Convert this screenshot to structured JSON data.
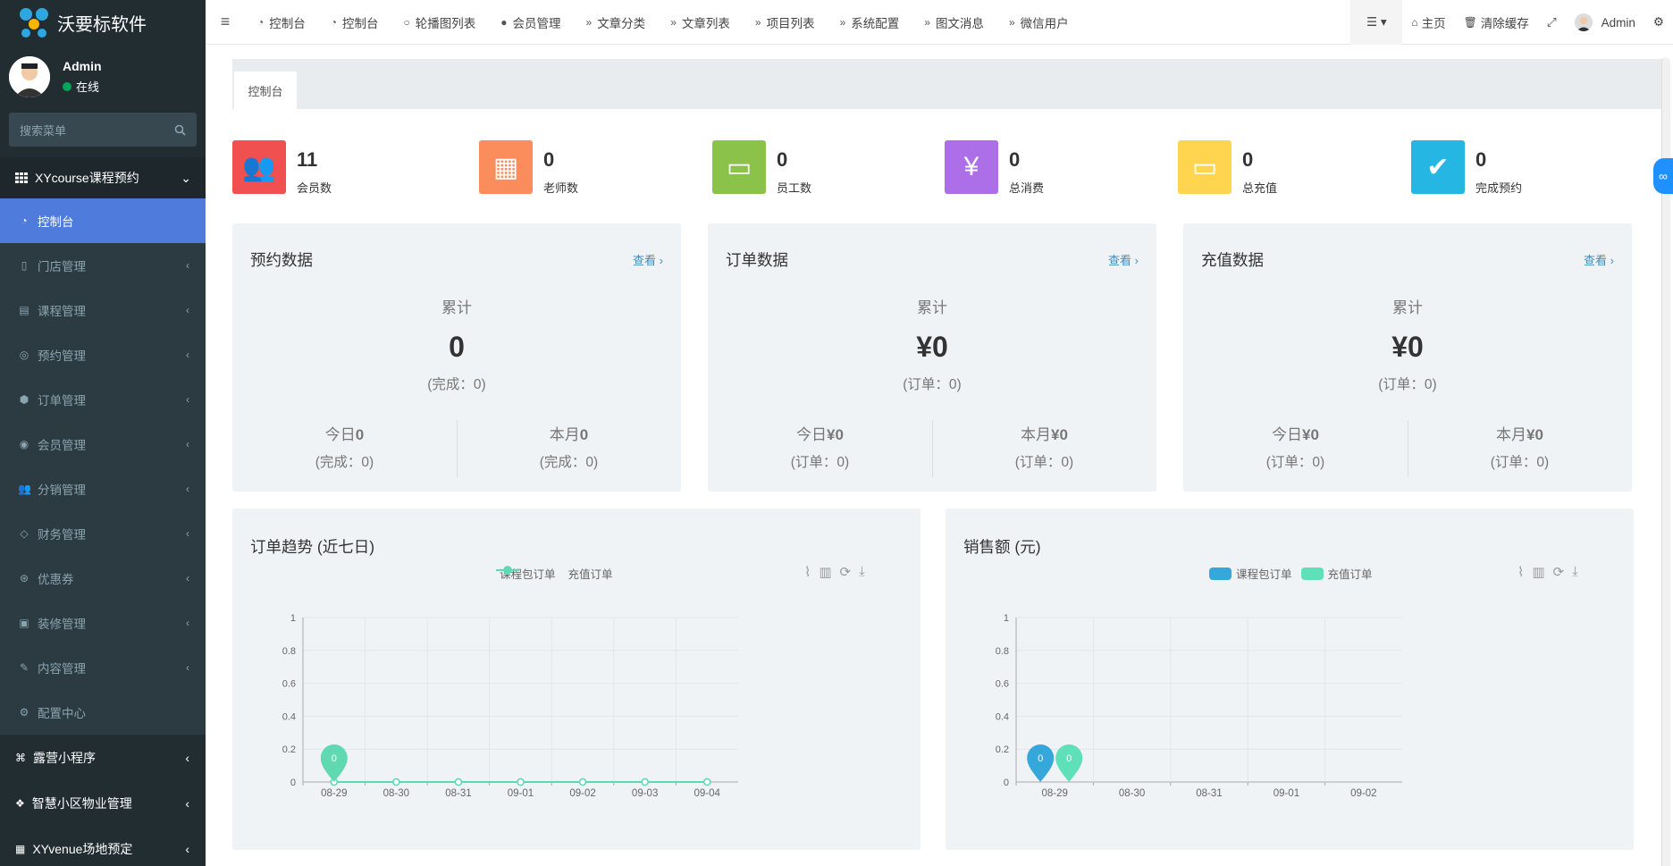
{
  "brand": {
    "name": "沃要标软件"
  },
  "user": {
    "name": "Admin",
    "status": "在线"
  },
  "search": {
    "placeholder": "搜索菜单"
  },
  "sidebar": {
    "group": "XYcourse课程预约",
    "items": [
      {
        "label": "控制台",
        "icon": "dashboard-icon"
      },
      {
        "label": "门店管理",
        "icon": "columns-icon"
      },
      {
        "label": "课程管理",
        "icon": "book-icon"
      },
      {
        "label": "预约管理",
        "icon": "whatsapp-icon"
      },
      {
        "label": "订单管理",
        "icon": "cube-icon"
      },
      {
        "label": "会员管理",
        "icon": "user-circle-icon"
      },
      {
        "label": "分销管理",
        "icon": "users-icon"
      },
      {
        "label": "财务管理",
        "icon": "diamond-icon"
      },
      {
        "label": "优惠券",
        "icon": "life-ring-icon"
      },
      {
        "label": "装修管理",
        "icon": "image-icon"
      },
      {
        "label": "内容管理",
        "icon": "edit-icon"
      },
      {
        "label": "配置中心",
        "icon": "gear-icon"
      }
    ],
    "groups2": [
      {
        "label": "露营小程序",
        "icon": "sliders-icon"
      },
      {
        "label": "智慧小区物业管理",
        "icon": "cubes-icon"
      },
      {
        "label": "XYvenue场地预定",
        "icon": "th-icon"
      }
    ]
  },
  "topnav": {
    "items": [
      {
        "label": "控制台",
        "icon": "dashboard-icon"
      },
      {
        "label": "控制台",
        "icon": "dashboard-icon"
      },
      {
        "label": "轮播图列表",
        "icon": "circle-icon"
      },
      {
        "label": "会员管理",
        "icon": "user-icon"
      },
      {
        "label": "文章分类",
        "icon": "angle-double-right-icon"
      },
      {
        "label": "文章列表",
        "icon": "angle-double-right-icon"
      },
      {
        "label": "项目列表",
        "icon": "angle-double-right-icon"
      },
      {
        "label": "系统配置",
        "icon": "angle-double-right-icon"
      },
      {
        "label": "图文消息",
        "icon": "angle-double-right-icon"
      },
      {
        "label": "微信用户",
        "icon": "angle-double-right-icon"
      }
    ],
    "home": "主页",
    "clear_cache": "清除缓存",
    "admin": "Admin"
  },
  "tab": {
    "label": "控制台"
  },
  "stats": [
    {
      "value": "11",
      "label": "会员数",
      "color": "#f05050",
      "icon": "users-icon"
    },
    {
      "value": "0",
      "label": "老师数",
      "color": "#fb8c5c",
      "icon": "grid-icon"
    },
    {
      "value": "0",
      "label": "员工数",
      "color": "#8bc34a",
      "icon": "id-badge-icon"
    },
    {
      "value": "0",
      "label": "总消费",
      "color": "#ac6fe8",
      "icon": "yen-icon"
    },
    {
      "value": "0",
      "label": "总充值",
      "color": "#ffd54f",
      "icon": "archive-icon"
    },
    {
      "value": "0",
      "label": "完成预约",
      "color": "#26b6e4",
      "icon": "check-circle-icon"
    }
  ],
  "cards": [
    {
      "title": "预约数据",
      "view": "查看 ›",
      "cum": "累计",
      "big": "0",
      "sub": "(完成：0)",
      "today_label": "今日",
      "today_value": "0",
      "today_sub": "(完成：0)",
      "month_label": "本月",
      "month_value": "0",
      "month_sub": "(完成：0)"
    },
    {
      "title": "订单数据",
      "view": "查看 ›",
      "cum": "累计",
      "big": "¥0",
      "sub": "(订单：0)",
      "today_label": "今日",
      "today_value": "¥0",
      "today_sub": "(订单：0)",
      "month_label": "本月",
      "month_value": "¥0",
      "month_sub": "(订单：0)"
    },
    {
      "title": "充值数据",
      "view": "查看 ›",
      "cum": "累计",
      "big": "¥0",
      "sub": "(订单：0)",
      "today_label": "今日",
      "today_value": "¥0",
      "today_sub": "(订单：0)",
      "month_label": "本月",
      "month_value": "¥0",
      "month_sub": "(订单：0)"
    }
  ],
  "chart_data": [
    {
      "type": "line",
      "title": "订单趋势 (近七日)",
      "categories": [
        "08-29",
        "08-30",
        "08-31",
        "09-01",
        "09-02",
        "09-03",
        "09-04"
      ],
      "series": [
        {
          "name": "课程包订单",
          "values": [
            0,
            0,
            0,
            0,
            0,
            0,
            0
          ],
          "color": "#49bfe0"
        },
        {
          "name": "充值订单",
          "values": [
            0,
            0,
            0,
            0,
            0,
            0,
            0
          ],
          "color": "#60d9b0"
        }
      ],
      "yticks": [
        "0",
        "0.2",
        "0.4",
        "0.6",
        "0.8",
        "1"
      ],
      "ylim": [
        0,
        1
      ],
      "markers": [
        {
          "series": 1,
          "index": 0,
          "label": "0"
        }
      ],
      "grid": true,
      "legend": "top-center"
    },
    {
      "type": "bar",
      "title": "销售额 (元)",
      "categories": [
        "08-29",
        "08-30",
        "08-31",
        "09-01",
        "09-02"
      ],
      "series": [
        {
          "name": "课程包订单",
          "values": [
            0,
            0,
            0,
            0,
            0
          ],
          "color": "#36a7db"
        },
        {
          "name": "充值订单",
          "values": [
            0,
            0,
            0,
            0,
            0
          ],
          "color": "#60e0b8"
        }
      ],
      "yticks": [
        "0",
        "0.2",
        "0.4",
        "0.6",
        "0.8",
        "1"
      ],
      "ylim": [
        0,
        1
      ],
      "markers": [
        {
          "series": 0,
          "index": 0,
          "label": "0"
        },
        {
          "series": 1,
          "index": 0,
          "label": "0"
        }
      ],
      "grid": true,
      "legend": "top-center"
    }
  ]
}
